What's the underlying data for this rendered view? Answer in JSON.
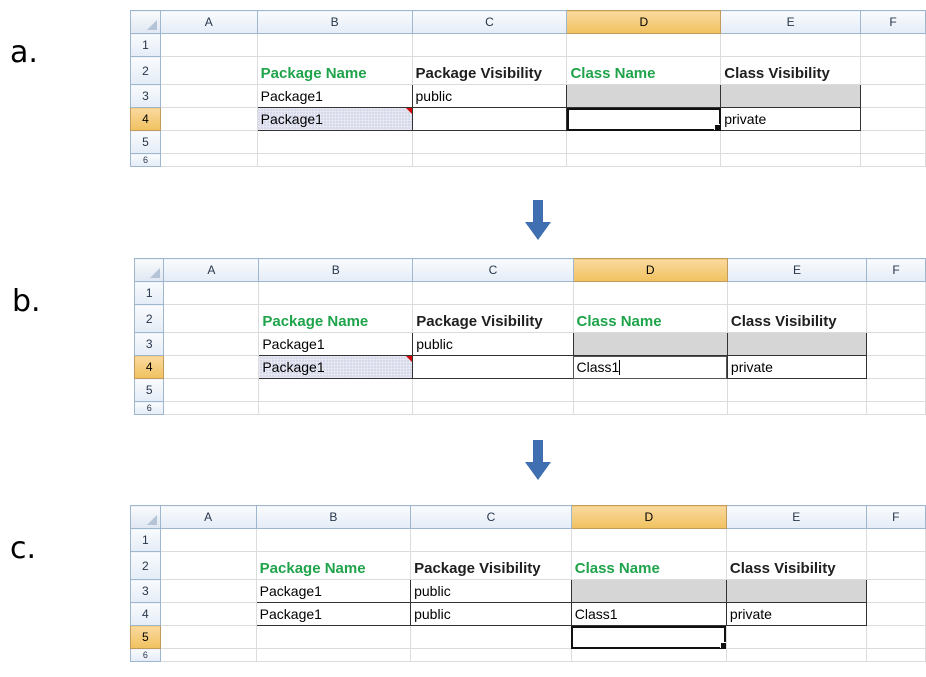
{
  "steps": [
    {
      "label": "a."
    },
    {
      "label": "b."
    },
    {
      "label": "c."
    }
  ],
  "columns": [
    "A",
    "B",
    "C",
    "D",
    "E",
    "F"
  ],
  "row_numbers": [
    "1",
    "2",
    "3",
    "4",
    "5",
    "6"
  ],
  "headers": {
    "package_name": "Package Name",
    "package_visibility": "Package Visibility",
    "class_name": "Class Name",
    "class_visibility": "Class Visibility"
  },
  "sheet_a": {
    "row3": {
      "package_name": "Package1",
      "package_visibility": "public",
      "class_name": "",
      "class_visibility": ""
    },
    "row4": {
      "package_name": "Package1",
      "package_visibility": "",
      "class_name": "",
      "class_visibility": "private"
    }
  },
  "sheet_b": {
    "row3": {
      "package_name": "Package1",
      "package_visibility": "public",
      "class_name": "",
      "class_visibility": ""
    },
    "row4": {
      "package_name": "Package1",
      "package_visibility": "",
      "class_name": "Class1",
      "class_visibility": "private"
    }
  },
  "sheet_c": {
    "row3": {
      "package_name": "Package1",
      "package_visibility": "public",
      "class_name": "",
      "class_visibility": ""
    },
    "row4": {
      "package_name": "Package1",
      "package_visibility": "public",
      "class_name": "Class1",
      "class_visibility": "private"
    }
  },
  "colors": {
    "green_header": "#1fa34b",
    "active_header": "#f1c15f",
    "arrow": "#3f6fb0",
    "gray_cell": "#d6d6d6"
  }
}
